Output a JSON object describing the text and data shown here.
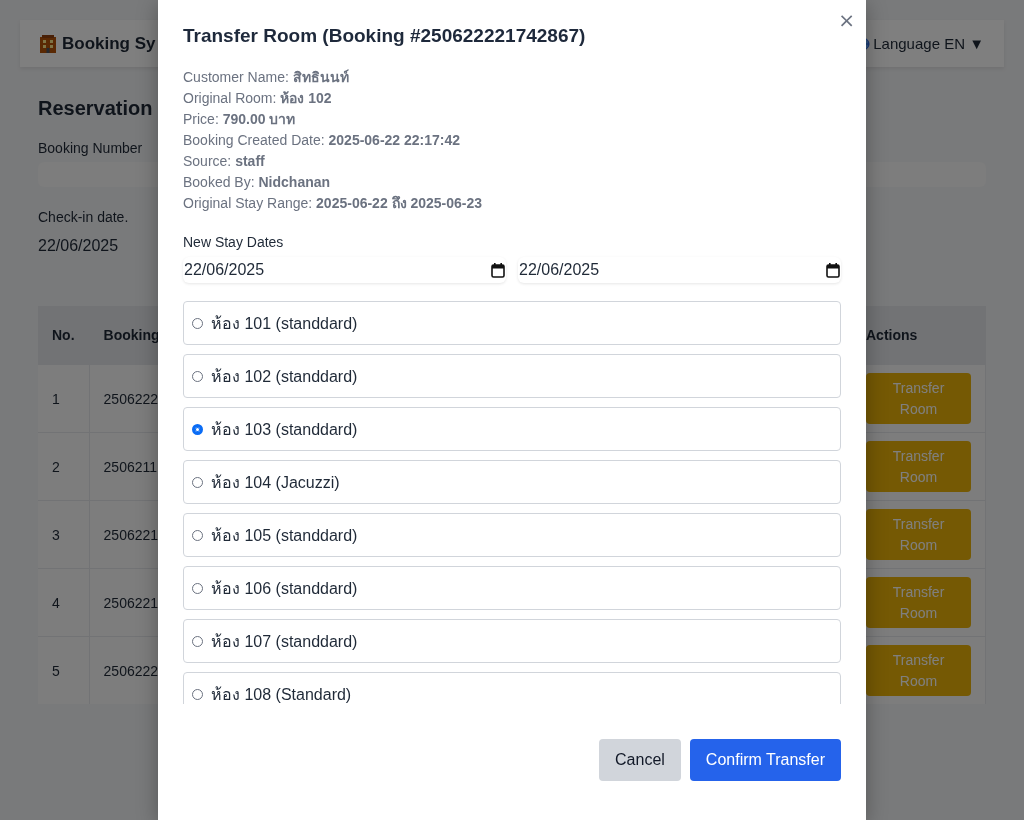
{
  "page": {
    "header": {
      "title": "Booking Sy",
      "language": "Language EN ▼"
    },
    "heading": "Reservation",
    "fields": [
      {
        "label": "Booking Number"
      },
      {
        "label": "Check-in date.",
        "value": "22/06/2025"
      }
    ],
    "table": {
      "columns": [
        "No.",
        "Booking",
        "Actions"
      ],
      "rows": [
        {
          "no": "1",
          "booking": "2506222",
          "action": "Transfer Room"
        },
        {
          "no": "2",
          "booking": "2506211",
          "action": "Transfer Room"
        },
        {
          "no": "3",
          "booking": "2506221",
          "action": "Transfer Room"
        },
        {
          "no": "4",
          "booking": "2506221",
          "action": "Transfer Room"
        },
        {
          "no": "5",
          "booking": "2506222",
          "action": "Transfer Room"
        }
      ]
    }
  },
  "modal": {
    "title": "Transfer Room (Booking #250622221742867)",
    "close": "×",
    "info": [
      "Customer Name: **สิทธินนท์**",
      "Original Room: **ห้อง 102**",
      "Price: **790.00 บาท**",
      "Booking Created Date: **2025-06-22 22:17:42**",
      "Source: **staff**",
      "Booked By: **Nidchanan**",
      "Original Stay Range: **2025-06-22 ถึง 2025-06-23**"
    ],
    "dates_label": "New Stay Dates",
    "dates": [
      "22/06/2025",
      "22/06/2025"
    ],
    "rooms": [
      {
        "label": "ห้อง 101 (standdard)",
        "selected": false
      },
      {
        "label": "ห้อง 102 (standdard)",
        "selected": false
      },
      {
        "label": "ห้อง 103 (standdard)",
        "selected": true
      },
      {
        "label": "ห้อง 104 (Jacuzzi)",
        "selected": false
      },
      {
        "label": "ห้อง 105 (standdard)",
        "selected": false
      },
      {
        "label": "ห้อง 106 (standdard)",
        "selected": false
      },
      {
        "label": "ห้อง 107 (standdard)",
        "selected": false
      },
      {
        "label": "ห้อง 108 (Standard)",
        "selected": false
      }
    ],
    "buttons": [
      {
        "label": "Cancel",
        "kind": "secondary"
      },
      {
        "label": "Confirm Transfer",
        "kind": "primary"
      }
    ]
  }
}
